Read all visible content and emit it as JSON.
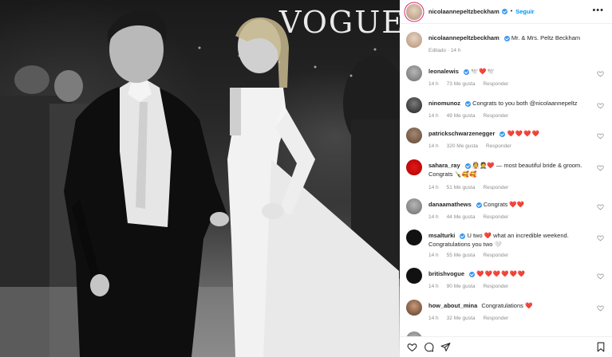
{
  "photo": {
    "watermark": "VOGUE"
  },
  "header": {
    "username": "nicolaannepeltzbeckham",
    "follow_label": "Seguir",
    "separator": "•"
  },
  "caption": {
    "username": "nicolaannepeltzbeckham",
    "text": "Mr. & Mrs. Peltz Beckham",
    "edited": "Editado · 14 h"
  },
  "comments": [
    {
      "username": "leonalewis",
      "text": "🕊️❤️🕊️",
      "time": "14 h",
      "likes": "73 Me gusta",
      "reply": "Responder",
      "verified": true
    },
    {
      "username": "ninomunoz",
      "text": "Congrats to you both @nicolaannepeltz",
      "time": "14 h",
      "likes": "49 Me gusta",
      "reply": "Responder",
      "verified": true
    },
    {
      "username": "patrickschwarzenegger",
      "text": "❤️❤️❤️❤️",
      "time": "14 h",
      "likes": "320 Me gusta",
      "reply": "Responder",
      "verified": true
    },
    {
      "username": "sahara_ray",
      "text": "👰🤵❤️ — most beautiful bride & groom. Congrats 🍾🥰🥰",
      "time": "14 h",
      "likes": "51 Me gusta",
      "reply": "Responder",
      "verified": true
    },
    {
      "username": "danaamathews",
      "text": "Congrats ❤️❤️",
      "time": "14 h",
      "likes": "44 Me gusta",
      "reply": "Responder",
      "verified": true
    },
    {
      "username": "msalturki",
      "text": "U two ❤️ what an incredible weekend. Congratulations you two 🤍",
      "time": "14 h",
      "likes": "55 Me gusta",
      "reply": "Responder",
      "verified": true
    },
    {
      "username": "britishvogue",
      "text": "❤️❤️❤️❤️❤️❤️",
      "time": "14 h",
      "likes": "90 Me gusta",
      "reply": "Responder",
      "verified": true
    },
    {
      "username": "how_about_mina",
      "text": "Congratulations ❤️",
      "time": "14 h",
      "likes": "32 Me gusta",
      "reply": "Responder",
      "verified": false
    }
  ],
  "icons": {
    "like": "heart-icon",
    "comment": "comment-icon",
    "share": "send-icon",
    "save": "bookmark-icon",
    "more": "more-options-icon"
  }
}
